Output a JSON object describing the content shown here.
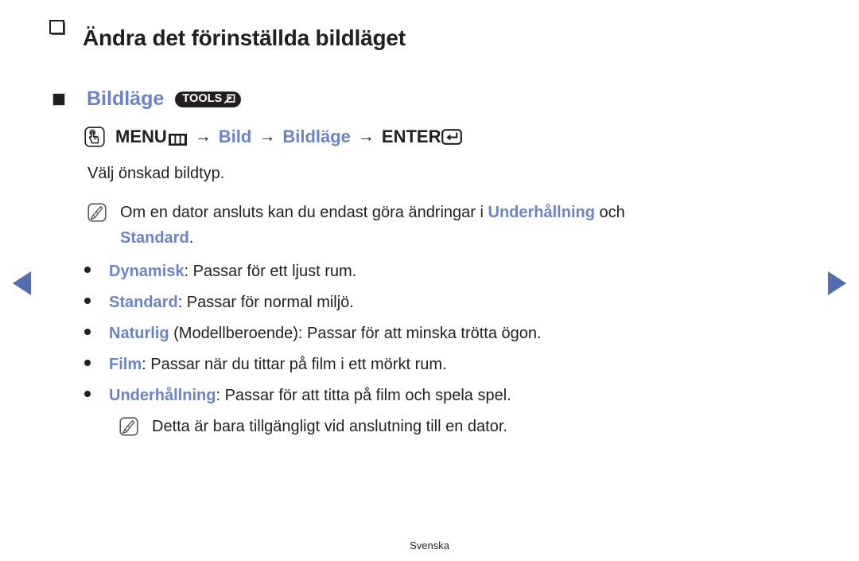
{
  "page": {
    "title": "Ändra det förinställda bildläget",
    "footer": "Svenska",
    "colors": {
      "accent_blue": "#6a84c6",
      "nav_arrow_blue": "#546cb0",
      "text_black": "#231f20"
    }
  },
  "nav": {
    "prev_label": "◀",
    "next_label": "▶"
  },
  "section": {
    "label": "Bildläge",
    "tools_badge": "TOOLS",
    "menu_path": {
      "press_icon": "press-button-icon",
      "menu_label": "MENU",
      "menu_icon": "menu-grid-icon",
      "arrow1": "→",
      "step1": "Bild",
      "arrow2": "→",
      "step2": "Bildläge",
      "arrow3": "→",
      "enter_label": "ENTER",
      "enter_icon": "enter-return-icon"
    },
    "intro": "Välj önskad bildtyp."
  },
  "notes": [
    {
      "icon": "note-pencil-icon",
      "text_before": "Om en dator ansluts kan du endast göra ändringar i ",
      "highlight1": "Underhållning",
      "text_middle": " och",
      "highlight2": "Standard",
      "text_after": "."
    },
    {
      "icon": "note-pencil-icon",
      "text": "Detta är bara tillgängligt vid anslutning till en dator."
    }
  ],
  "picture_modes": [
    {
      "term": "Dynamisk",
      "description": ": Passar för ett ljust rum."
    },
    {
      "term": "Standard",
      "description": ": Passar för normal miljö."
    },
    {
      "term": "Naturlig",
      "description": " (Modellberoende): Passar för att minska trötta ögon."
    },
    {
      "term": "Film",
      "description": ": Passar när du tittar på film i ett mörkt rum."
    },
    {
      "term": "Underhållning",
      "description": ": Passar för att titta på film och spela spel."
    }
  ]
}
